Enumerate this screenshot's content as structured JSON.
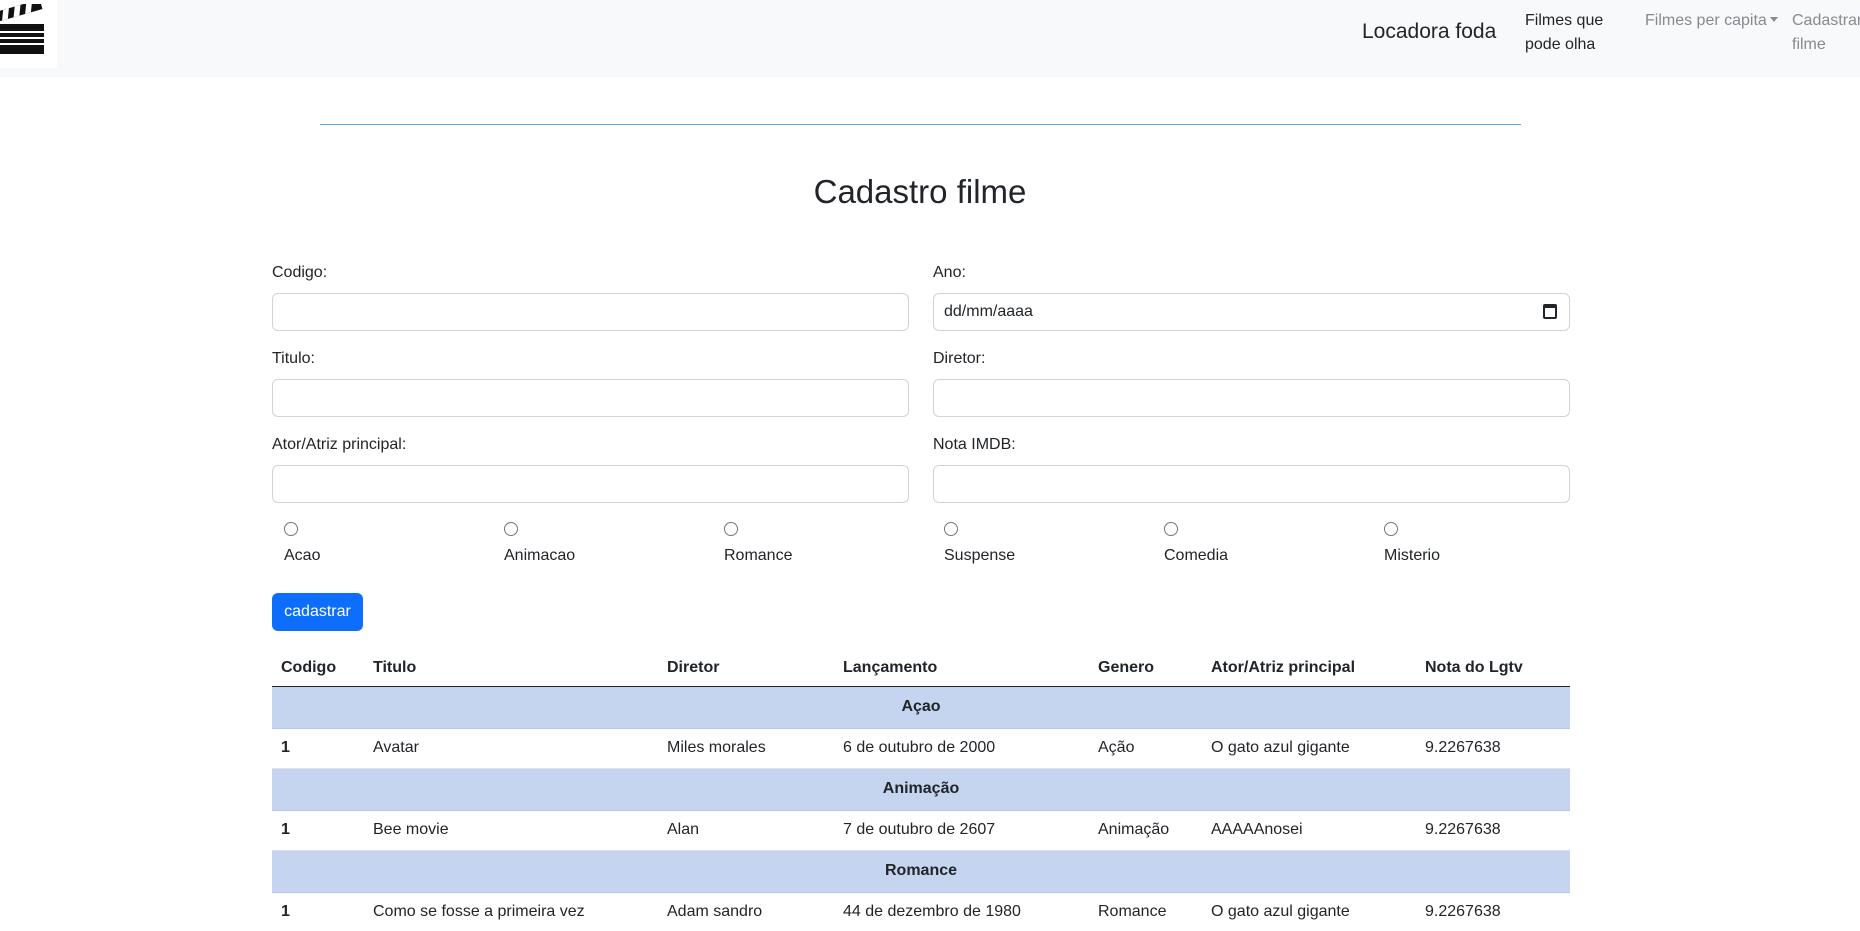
{
  "navbar": {
    "logo_icon": "clapperboard-icon",
    "brand": "Locadora foda",
    "links": [
      {
        "label_line1": "Filmes que",
        "label_line2": "pode olha"
      },
      {
        "label": "Filmes per capita"
      },
      {
        "label_line1": "Cadastrar",
        "label_line2": "filme"
      }
    ]
  },
  "page": {
    "title": "Cadastro filme"
  },
  "form": {
    "codigo": {
      "label": "Codigo:",
      "value": ""
    },
    "ano": {
      "label": "Ano:",
      "placeholder": "dd/mm/aaaa"
    },
    "titulo": {
      "label": "Titulo:",
      "value": ""
    },
    "diretor": {
      "label": "Diretor:",
      "value": ""
    },
    "ator": {
      "label": "Ator/Atriz principal:",
      "value": ""
    },
    "nota": {
      "label": "Nota IMDB:",
      "value": ""
    },
    "genres": [
      "Acao",
      "Animacao",
      "Romance",
      "Suspense",
      "Comedia",
      "Misterio"
    ],
    "submit_label": "cadastrar"
  },
  "table": {
    "headers": [
      "Codigo",
      "Titulo",
      "Diretor",
      "Lançamento",
      "Genero",
      "Ator/Atriz principal",
      "Nota do Lgtv"
    ],
    "groups": [
      {
        "name": "Açao",
        "rows": [
          {
            "codigo": "1",
            "titulo": "Avatar",
            "diretor": "Miles morales",
            "lancamento": "6 de outubro de 2000",
            "genero": "Ação",
            "ator": "O gato azul gigante",
            "nota": "9.2267638"
          }
        ]
      },
      {
        "name": "Animação",
        "rows": [
          {
            "codigo": "1",
            "titulo": "Bee movie",
            "diretor": "Alan",
            "lancamento": "7 de outubro de 2607",
            "genero": "Animação",
            "ator": "AAAAAnosei",
            "nota": "9.2267638"
          }
        ]
      },
      {
        "name": "Romance",
        "rows": [
          {
            "codigo": "1",
            "titulo": "Como se fosse a primeira vez",
            "diretor": "Adam sandro",
            "lancamento": "44 de dezembro de 1980",
            "genero": "Romance",
            "ator": "O gato azul gigante",
            "nota": "9.2267638"
          }
        ]
      }
    ]
  },
  "colors": {
    "primary": "#0d6efd",
    "group_row": "#c5d5f0",
    "navbar_bg": "#f8f9fa",
    "divider": "#5aa7e6"
  }
}
